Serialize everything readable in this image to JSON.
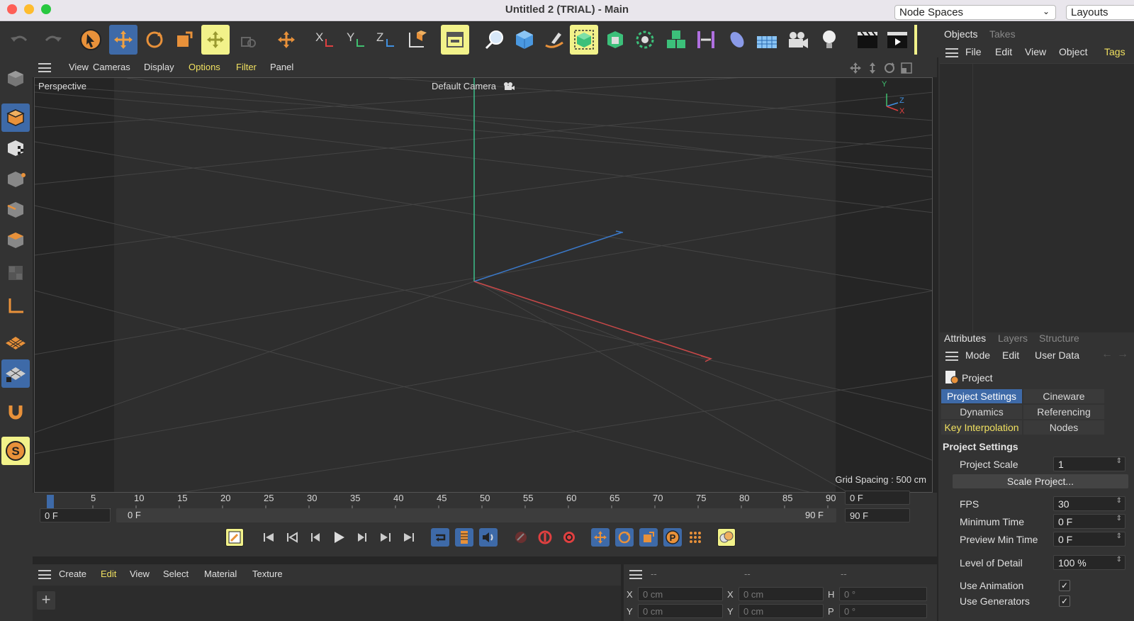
{
  "window": {
    "title": "Untitled 2 (TRIAL) - Main",
    "node_spaces": "Node Spaces",
    "layouts": "Layouts"
  },
  "viewport": {
    "menu": [
      "View",
      "Cameras",
      "Display",
      "Options",
      "Filter",
      "Panel"
    ],
    "view_name": "Perspective",
    "camera": "Default Camera",
    "grid_spacing": "Grid Spacing : 500 cm",
    "axis_labels": {
      "y": "Y",
      "z": "Z",
      "x": "X"
    }
  },
  "timeline": {
    "ticks": [
      "0",
      "5",
      "10",
      "15",
      "20",
      "25",
      "30",
      "35",
      "40",
      "45",
      "50",
      "55",
      "60",
      "65",
      "70",
      "75",
      "80",
      "85",
      "90"
    ],
    "current_frame": "0 F",
    "start_field": "0 F",
    "range_start": "0 F",
    "range_end": "90 F",
    "end_field": "90 F",
    "max_field": "90 F"
  },
  "material_manager": {
    "menu": [
      "Create",
      "Edit",
      "View",
      "Select",
      "Material",
      "Texture"
    ]
  },
  "coordinates": {
    "headers": [
      "--",
      "--",
      "--"
    ],
    "row1": {
      "l1": "X",
      "v1": "0 cm",
      "l2": "X",
      "v2": "0 cm",
      "l3": "H",
      "v3": "0 °"
    },
    "row2": {
      "l1": "Y",
      "v1": "0 cm",
      "l2": "Y",
      "v2": "0 cm",
      "l3": "P",
      "v3": "0 °"
    }
  },
  "objects_panel": {
    "tabs": [
      "Objects",
      "Takes"
    ],
    "menu": [
      "File",
      "Edit",
      "View",
      "Object",
      "Tags"
    ]
  },
  "attributes_panel": {
    "tabs": [
      "Attributes",
      "Layers",
      "Structure"
    ],
    "menu": [
      "Mode",
      "Edit",
      "User Data"
    ],
    "object_name": "Project",
    "subtabs": [
      "Project Settings",
      "Cineware",
      "Dynamics",
      "Referencing",
      "Key Interpolation",
      "Nodes"
    ],
    "section_title": "Project Settings",
    "fields": {
      "project_scale_label": "Project Scale",
      "project_scale": "1",
      "scale_button": "Scale Project...",
      "fps_label": "FPS",
      "fps": "30",
      "min_time_label": "Minimum Time",
      "min_time": "0 F",
      "preview_min_label": "Preview Min Time",
      "preview_min": "0 F",
      "lod_label": "Level of Detail",
      "lod": "100 %",
      "use_animation_label": "Use Animation",
      "use_generators_label": "Use Generators"
    }
  },
  "colors": {
    "accent_blue": "#3e6aa8",
    "highlight_yellow": "#f2f28a",
    "orange": "#e8913a",
    "menu_highlight": "#f0e060"
  }
}
